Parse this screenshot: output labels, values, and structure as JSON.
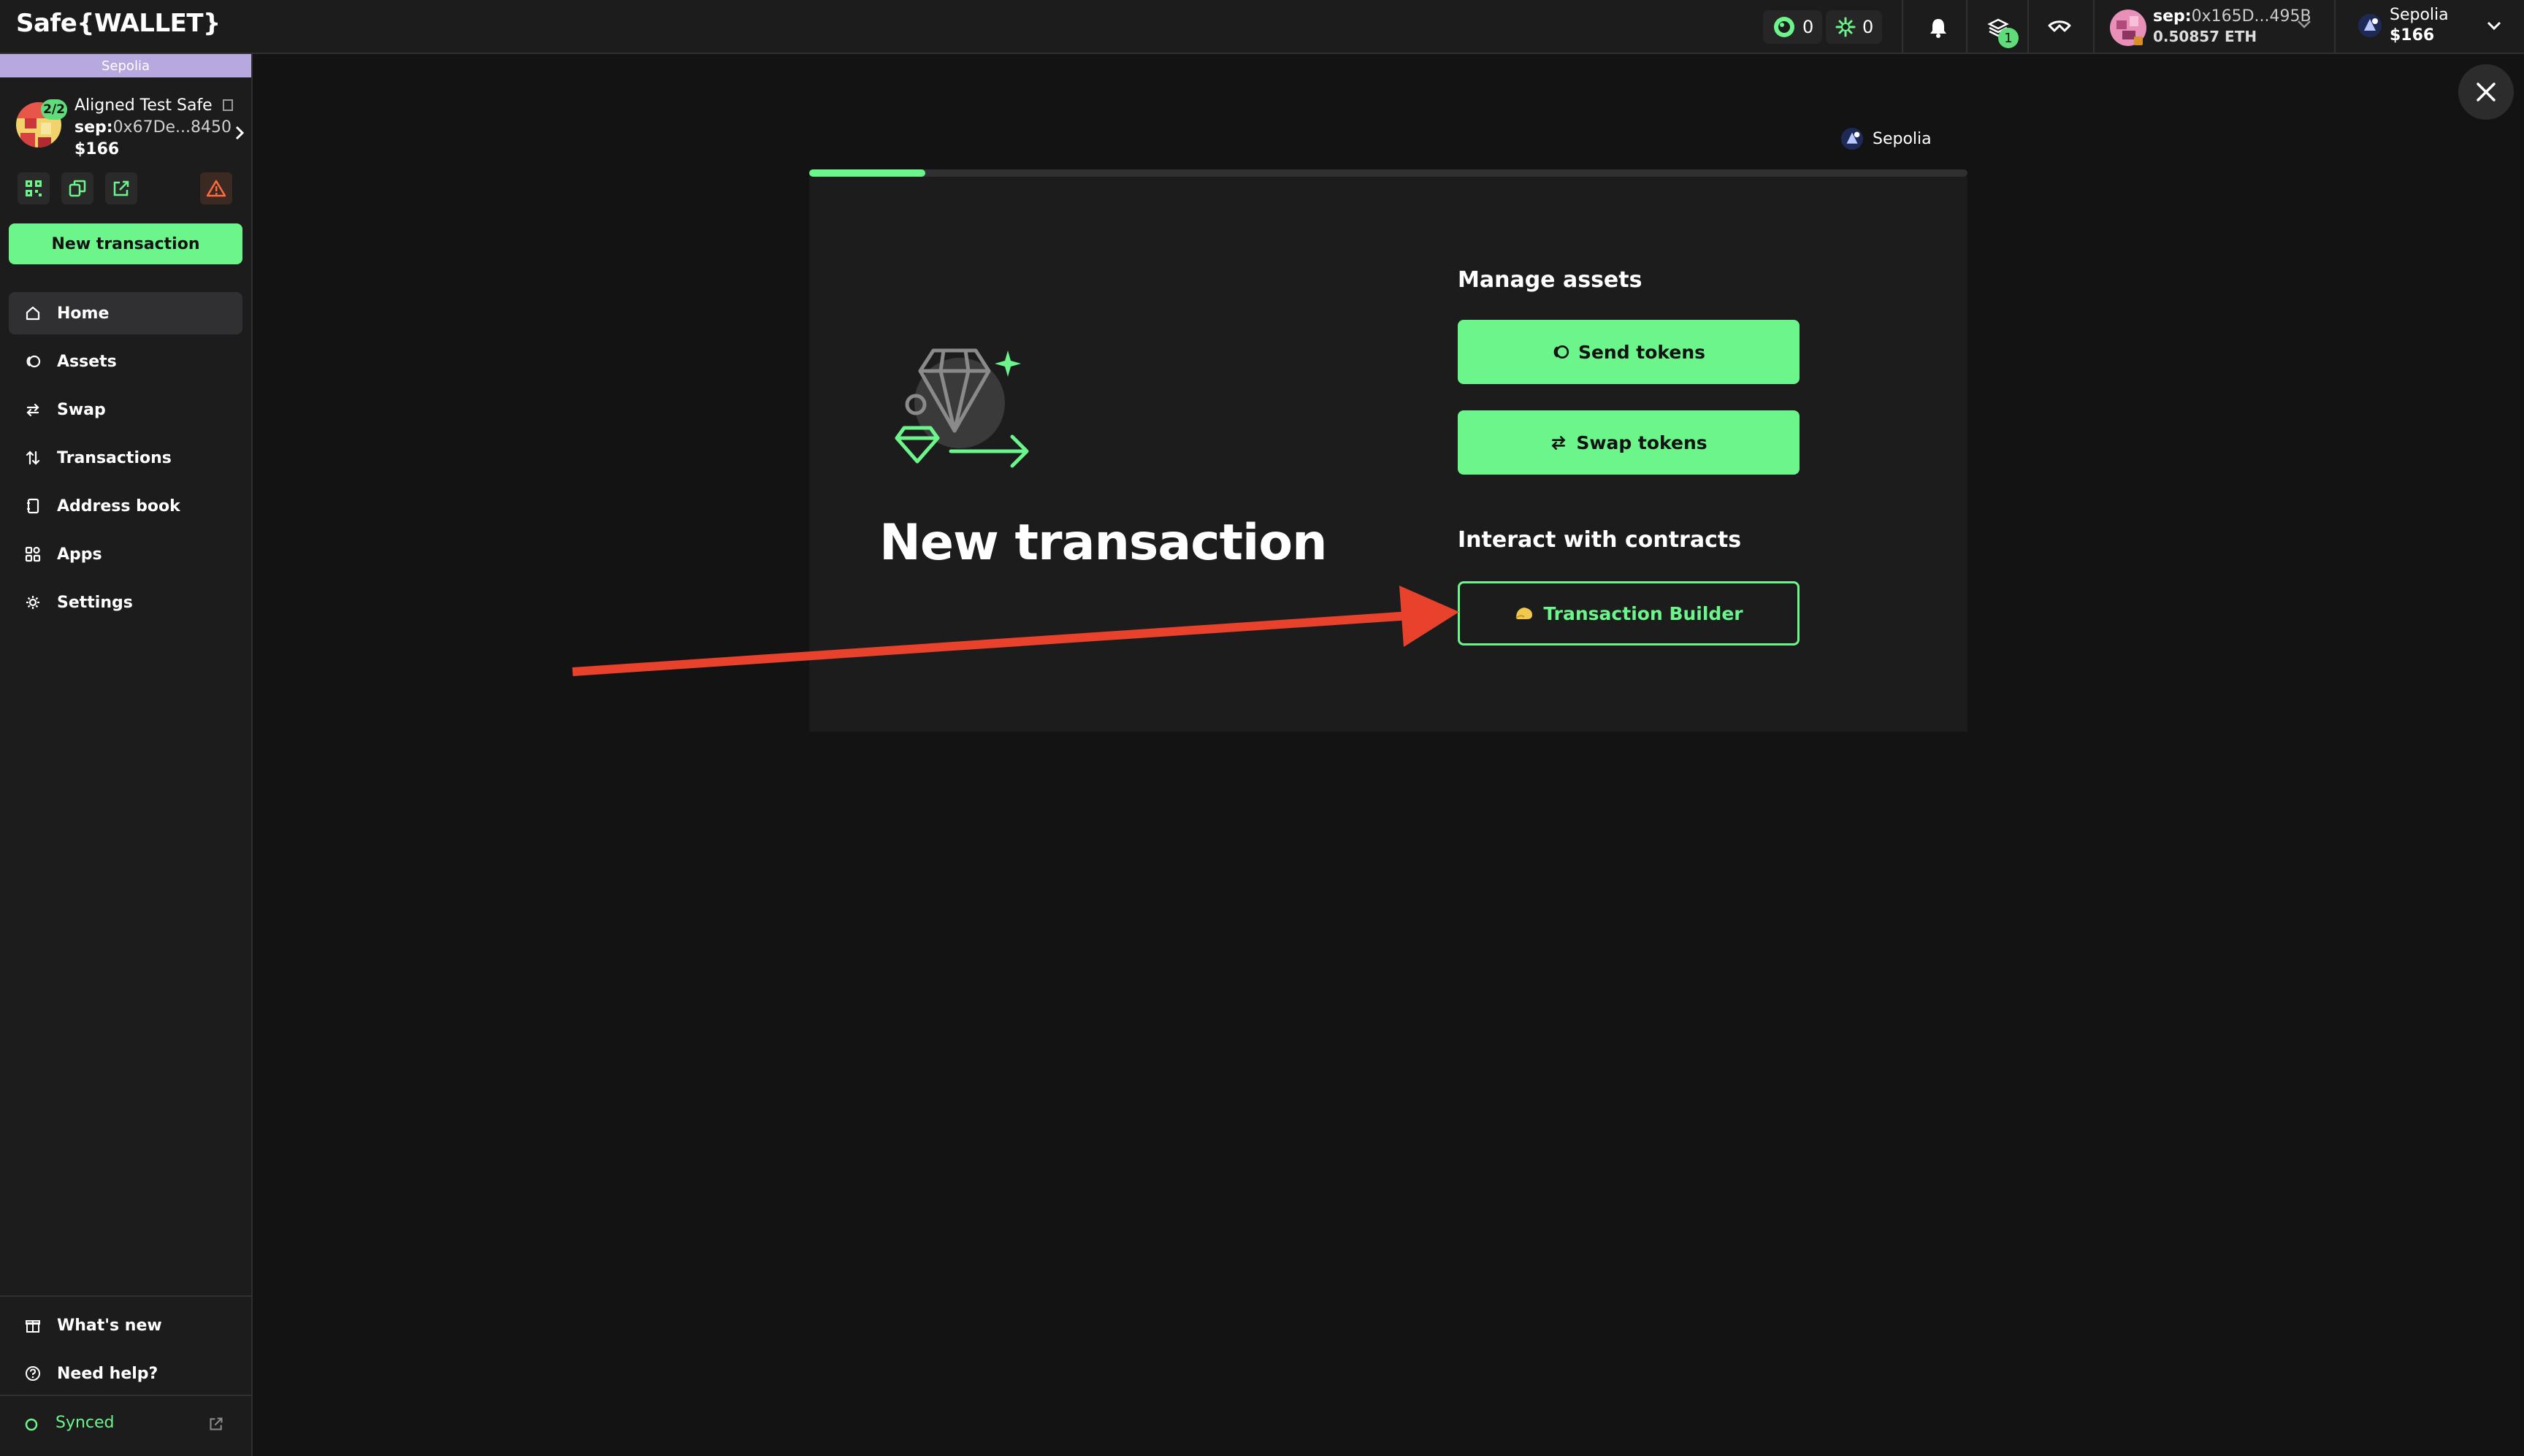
{
  "header": {
    "brand": "Safe{WALLET}",
    "counter_a": "0",
    "counter_b": "0",
    "notifications_icon": "bell-icon",
    "queue_badge": "1",
    "account": {
      "address_prefix": "sep:",
      "address": "0x165D...495B",
      "balance": "0.50857 ETH"
    },
    "network": {
      "name": "Sepolia",
      "balance": "$166"
    }
  },
  "sidebar": {
    "chain_strip": "Sepolia",
    "safe": {
      "threshold": "2/2",
      "name": "Aligned Test Safe",
      "address_prefix": "sep:",
      "address": "0x67De...8450",
      "balance": "$166"
    },
    "new_transaction": "New transaction",
    "nav": [
      {
        "label": "Home",
        "icon": "home-icon",
        "active": true
      },
      {
        "label": "Assets",
        "icon": "assets-icon"
      },
      {
        "label": "Swap",
        "icon": "swap-icon"
      },
      {
        "label": "Transactions",
        "icon": "transactions-icon"
      },
      {
        "label": "Address book",
        "icon": "address-book-icon"
      },
      {
        "label": "Apps",
        "icon": "apps-icon"
      },
      {
        "label": "Settings",
        "icon": "settings-icon"
      }
    ],
    "footer": [
      {
        "label": "What's new",
        "icon": "gift-icon"
      },
      {
        "label": "Need help?",
        "icon": "help-icon"
      }
    ],
    "status": "Synced"
  },
  "main": {
    "chain": "Sepolia",
    "progress": 0.1,
    "title": "New transaction",
    "manage_assets": {
      "heading": "Manage assets",
      "send": "Send tokens",
      "swap": "Swap tokens"
    },
    "interact": {
      "heading": "Interact with contracts",
      "builder": "Transaction Builder"
    }
  },
  "colors": {
    "accent": "#6cf58a",
    "background": "#121312",
    "panel": "#1c1c1c",
    "annotation_arrow": "#e8412c"
  }
}
